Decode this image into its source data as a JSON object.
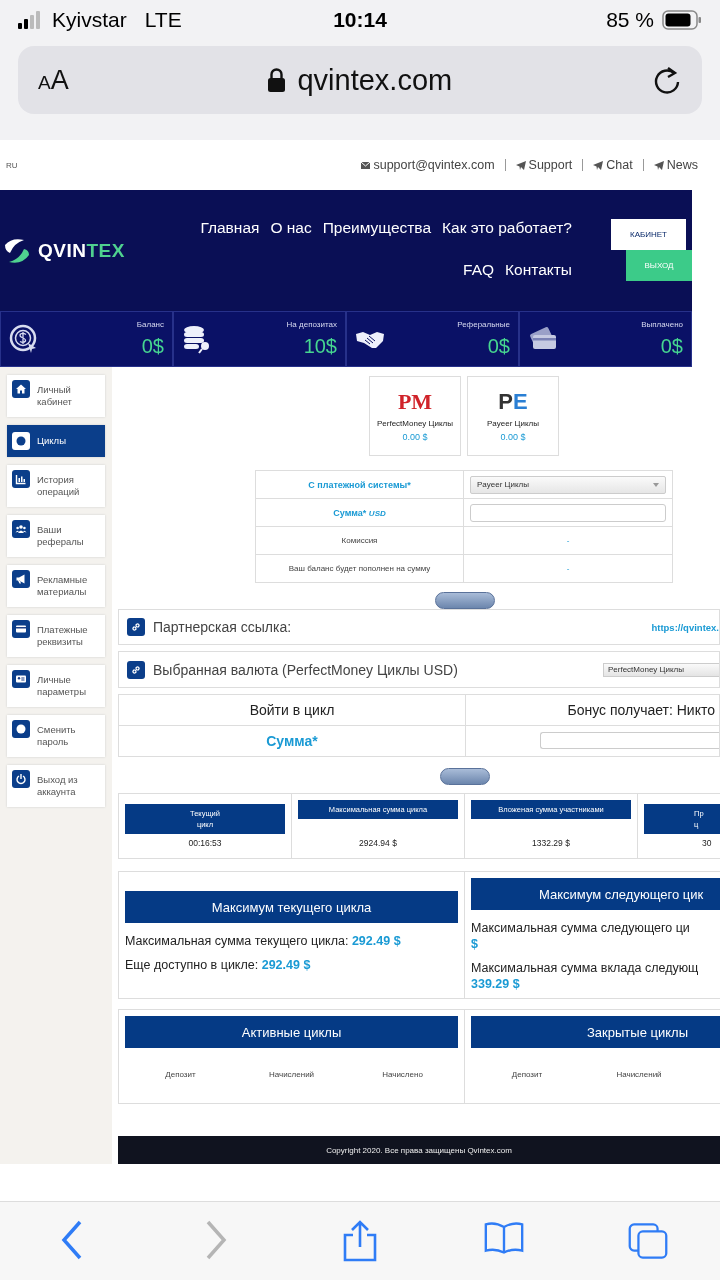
{
  "status_bar": {
    "carrier": "Kyivstar",
    "network": "LTE",
    "time": "10:14",
    "battery": "85 %"
  },
  "browser": {
    "text_size_small": "A",
    "text_size_large": "A",
    "url": "qvintex.com"
  },
  "top_bar": {
    "language": "RU",
    "links": [
      {
        "kind": "mail",
        "label": "support@qvintex.com"
      },
      {
        "kind": "telegram",
        "label": "Support"
      },
      {
        "kind": "telegram",
        "label": "Chat"
      },
      {
        "kind": "telegram",
        "label": "News"
      }
    ]
  },
  "header": {
    "logo_main": "QVIN",
    "logo_accent": "TEX",
    "nav": [
      "Главная",
      "О нас",
      "Преимущества",
      "Как это работает?",
      "FAQ",
      "Контакты"
    ],
    "buttons": [
      {
        "kind": "light",
        "label": "КАБИНЕТ"
      },
      {
        "kind": "green",
        "label": "ВЫХОД"
      }
    ]
  },
  "stats": [
    {
      "label": "Баланс",
      "value": "0$"
    },
    {
      "label": "На депозитах",
      "value": "10$"
    },
    {
      "label": "Реферальные",
      "value": "0$"
    },
    {
      "label": "Выплачено",
      "value": "0$"
    }
  ],
  "sidebar": {
    "items": [
      {
        "label": "Личный кабинет",
        "selected": false
      },
      {
        "label": "Циклы",
        "selected": true
      },
      {
        "label": "История операций",
        "selected": false
      },
      {
        "label": "Ваши рефералы",
        "selected": false
      },
      {
        "label": "Рекламные материалы",
        "selected": false
      },
      {
        "label": "Платежные реквизиты",
        "selected": false
      },
      {
        "label": "Личные параметры",
        "selected": false
      },
      {
        "label": "Сменить пароль",
        "selected": false
      },
      {
        "label": "Выход из аккаунта",
        "selected": false
      }
    ]
  },
  "wallets": [
    {
      "kind": "pm",
      "logo": "PM",
      "name": "PerfectMoney Циклы",
      "amount": "0.00 $"
    },
    {
      "kind": "pe",
      "logo": "PE",
      "name": "Payeer Циклы",
      "amount": "0.00 $"
    }
  ],
  "deposit_form": {
    "rows": [
      {
        "kind": "select",
        "label": "С платежной системы*",
        "value": "Payeer Циклы"
      },
      {
        "kind": "input",
        "label": "Сумма*",
        "suffix": "USD"
      },
      {
        "kind": "text",
        "label": "Комиссия",
        "value": "-"
      },
      {
        "kind": "text",
        "label": "Ваш баланс будет пополнен на сумму",
        "value": "-"
      }
    ]
  },
  "partner_link": {
    "label": "Партнерская ссылка:",
    "value": "https://qvintex."
  },
  "currency": {
    "label": "Выбранная валюта (PerfectMoney Циклы USD)",
    "select": "PerfectMoney Циклы"
  },
  "join": {
    "title": "Войти в цикл",
    "bonus": "Бонус получает: Никто",
    "amount_label": "Сумма*"
  },
  "cycle_stats": [
    {
      "label": "Текущий\nцикл",
      "value": "00:16:53"
    },
    {
      "label": "Максимальная сумма цикла",
      "value": "2924.94 $"
    },
    {
      "label": "Вложеная сумма участниками",
      "value": "1332.29 $"
    },
    {
      "label": "Пр\nц",
      "value": "30"
    }
  ],
  "max_panels": [
    {
      "kind": "inline",
      "title": "Максимум текущего цикла",
      "lines": [
        {
          "text": "Максимальная сумма текущего цикла:",
          "value": "292.49 $"
        },
        {
          "text": "Еще доступно в цикле:",
          "value": "292.49 $"
        }
      ]
    },
    {
      "kind": "block",
      "title": "Максимум следующего цик",
      "lines": [
        {
          "text": "Максимальная сумма следующего ци",
          "value": "$"
        },
        {
          "text": "Максимальная сумма вклада следующ",
          "value": "339.29 $"
        }
      ]
    }
  ],
  "cycle_lists": [
    {
      "title": "Активные циклы",
      "columns": [
        "Депозит",
        "Начислений",
        "Начислено"
      ]
    },
    {
      "title": "Закрытые циклы",
      "columns": [
        "Депозит",
        "Начислений"
      ]
    }
  ],
  "footer": "Copyright 2020. Все права защищены Qvintex.com"
}
